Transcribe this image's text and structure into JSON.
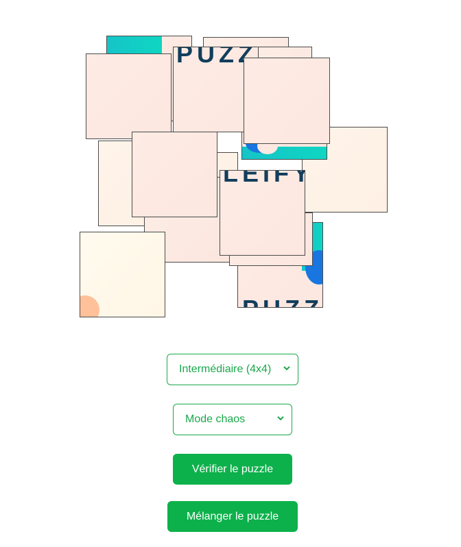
{
  "puzzle": {
    "tile_text": {
      "top": "PUZZ",
      "middle": "LEIFY",
      "bottom": "PUZZ"
    },
    "colors": {
      "tile_pink": "#fde8e1",
      "tile_cream": "#fff4ea",
      "teal": "#16c4c8",
      "blue": "#1976e0",
      "text_navy": "#123e5c",
      "border": "#4a4a4a"
    }
  },
  "controls": {
    "difficulty_select": {
      "value": "Intermédiaire (4x4)"
    },
    "mode_select": {
      "value": "Mode chaos"
    },
    "check_button": "Vérifier le puzzle",
    "shuffle_button": "Mélanger le puzzle",
    "accent": "#0db14b"
  }
}
